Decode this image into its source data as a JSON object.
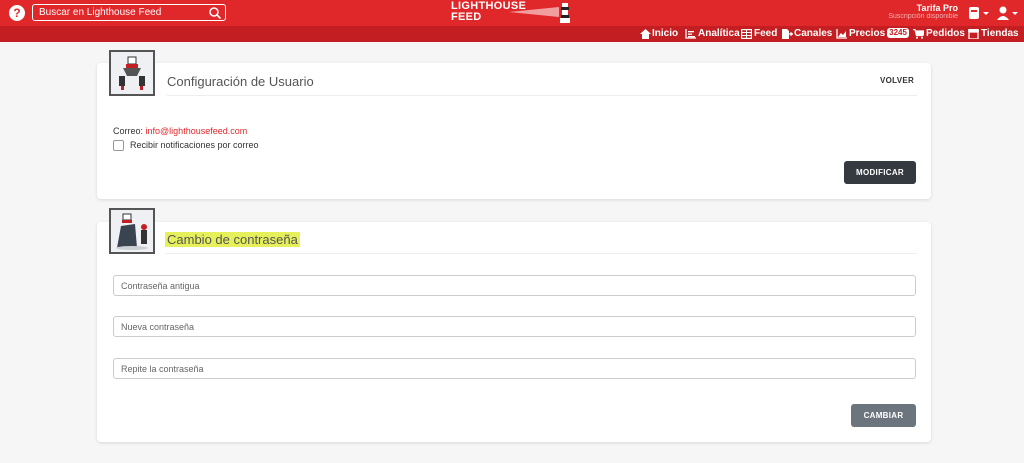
{
  "header": {
    "help_icon": "question-icon",
    "help_glyph": "?",
    "search_placeholder": "Buscar en Lighthouse Feed",
    "logo_line1": "LIGHTHOUSE",
    "logo_line2": "FEED",
    "plan_name": "Tarifa Pro",
    "plan_sub": "Suscripción disponible",
    "colors": {
      "primary": "#e0282b",
      "nav": "#c31e21"
    }
  },
  "nav": {
    "items": [
      {
        "label": "Inicio",
        "icon": "home-icon"
      },
      {
        "label": "Analítica",
        "icon": "analytics-icon"
      },
      {
        "label": "Feed",
        "icon": "table-icon"
      },
      {
        "label": "Canales",
        "icon": "export-icon"
      },
      {
        "label": "Precios",
        "icon": "chart-icon",
        "badge": "3245"
      },
      {
        "label": "Pedidos",
        "icon": "cart-icon"
      },
      {
        "label": "Tiendas",
        "icon": "store-icon"
      }
    ]
  },
  "user_settings": {
    "title": "Configuración de Usuario",
    "back_label": "VOLVER",
    "email_label": "Correo:",
    "email_value": "info@lighthousefeed.com",
    "notify_label": "Recibir notificaciones por correo",
    "notify_checked": false,
    "modify_label": "MODIFICAR"
  },
  "password": {
    "title": "Cambio de contraseña",
    "old_placeholder": "Contraseña antigua",
    "new_placeholder": "Nueva contraseña",
    "repeat_placeholder": "Repite la contraseña",
    "submit_label": "CAMBIAR"
  }
}
